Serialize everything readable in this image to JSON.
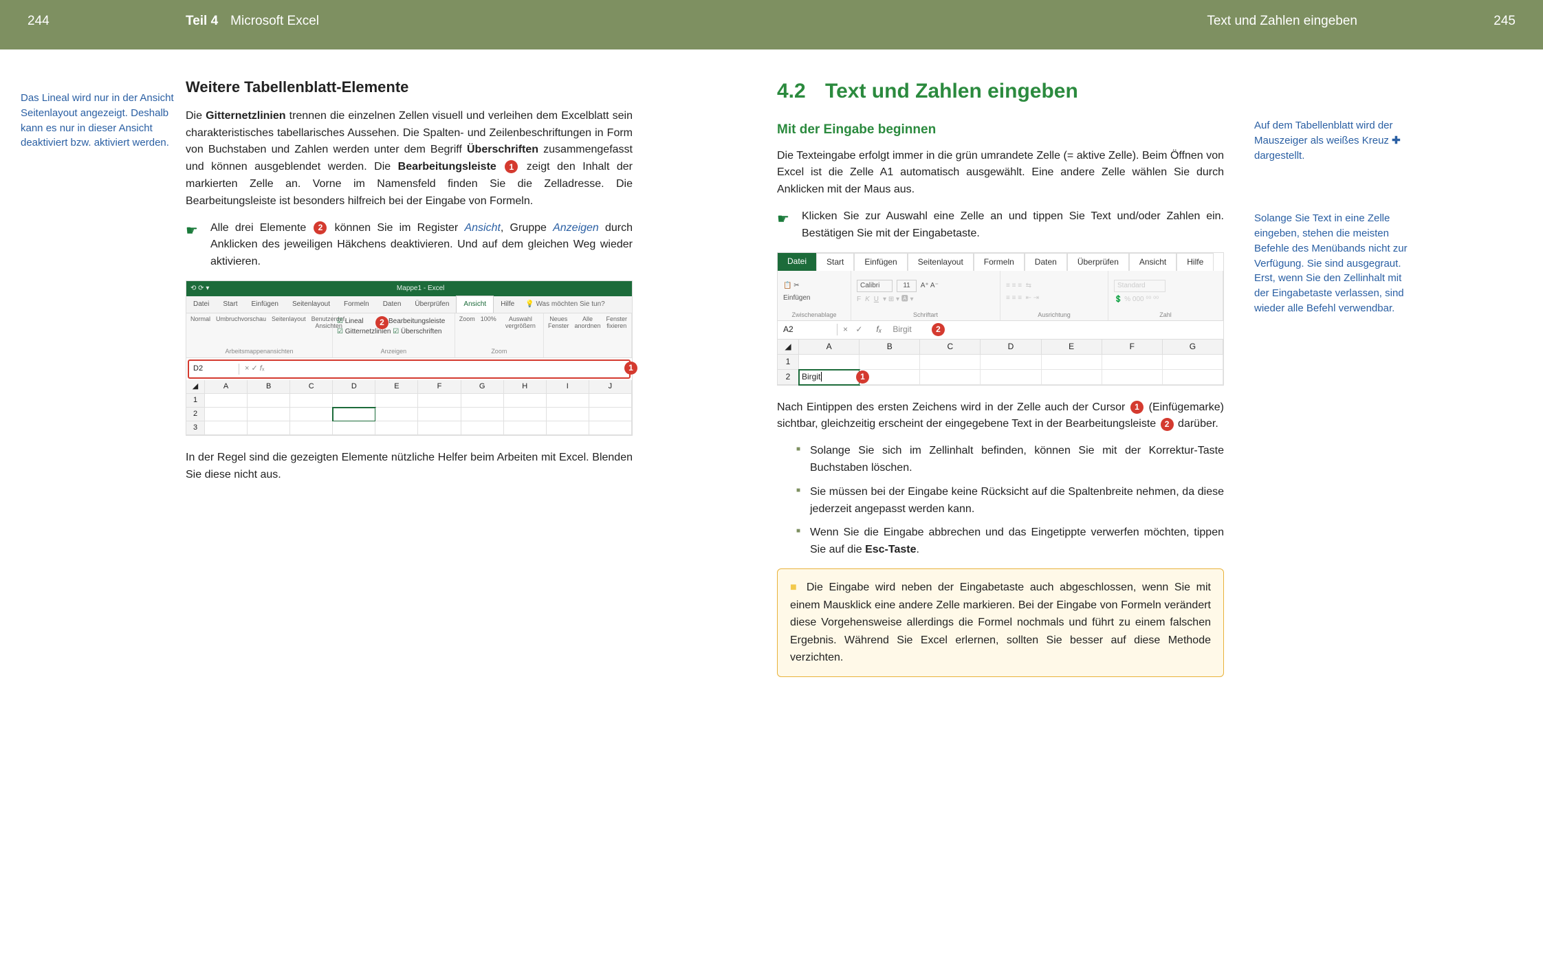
{
  "header": {
    "page_left": "244",
    "part": "Teil 4",
    "part_title": "Microsoft Excel",
    "right_title": "Text und Zahlen eingeben",
    "page_right": "245"
  },
  "left": {
    "margin_note": "Das Lineal wird nur in der Ansicht Seitenlayout angezeigt.  Deshalb kann es nur in dieser Ansicht deaktiviert bzw. aktiviert werden.",
    "h3": "Weitere Tabellenblatt-Elemente",
    "p1_pre": "Die ",
    "p1_b1": "Gitternetzlinien",
    "p1_mid1": " trennen die einzelnen Zellen visuell und verleihen dem Excelblatt sein charakteristisches tabellarisches Aussehen. Die Spalten- und Zeilenbeschriftungen in Form von Buchstaben und Zahlen werden unter dem Begriff ",
    "p1_b2": "Überschriften",
    "p1_mid2": " zusammengefasst und können ausgeblendet werden. Die ",
    "p1_b3": "Bearbeitungsleiste",
    "p1_mid3": " zeigt den Inhalt der markierten Zelle an. Vorne im Namensfeld finden Sie die Zelladresse. Die Bearbeitungsleiste ist besonders hilfreich bei der Eingabe von Formeln.",
    "tip_pre": "Alle drei Elemente ",
    "tip_mid": " können Sie im Register ",
    "tip_link1": "Ansicht",
    "tip_mid2": ", Gruppe ",
    "tip_link2": "Anzeigen",
    "tip_post": " durch Anklicken des jeweiligen Häkchens deaktivieren. Und auf dem gleichen Weg wieder aktivieren.",
    "p2": "In der Regel sind die gezeigten Elemente nützliche Helfer beim Arbeiten mit Excel. Blenden Sie diese nicht aus.",
    "screenshot": {
      "title": "Mappe1 - Excel",
      "tabs": [
        "Datei",
        "Start",
        "Einfügen",
        "Seitenlayout",
        "Formeln",
        "Daten",
        "Überprüfen",
        "Ansicht",
        "Hilfe"
      ],
      "tell": "Was möchten Sie tun?",
      "views": [
        "Normal",
        "Umbruchvorschau",
        "Seitenlayout",
        "Benutzerdef. Ansichten"
      ],
      "views_group": "Arbeitsmappenansichten",
      "show_opts": [
        "Lineal",
        "Bearbeitungsleiste",
        "Gitternetzlinien",
        "Überschriften"
      ],
      "show_group": "Anzeigen",
      "zoom": [
        "Zoom",
        "100%",
        "Auswahl vergrößern"
      ],
      "zoom_group": "Zoom",
      "window": [
        "Neues Fenster",
        "Alle anordnen",
        "Fenster fixieren"
      ],
      "namebox": "D2",
      "cols": [
        "A",
        "B",
        "C",
        "D",
        "E",
        "F",
        "G",
        "H",
        "I",
        "J"
      ],
      "rows": [
        "1",
        "2",
        "3"
      ]
    }
  },
  "right": {
    "sec_num": "4.2",
    "sec_title": "Text und Zahlen eingeben",
    "h3": "Mit der Eingabe beginnen",
    "p1": "Die Texteingabe erfolgt immer in die grün umrandete Zelle (= aktive Zelle). Beim Öffnen von Excel ist die Zelle A1 automatisch ausgewählt. Eine andere Zelle wählen Sie durch Anklicken mit der Maus aus.",
    "tip": "Klicken Sie zur Auswahl eine Zelle an und tippen Sie Text und/oder Zahlen ein. Bestätigen Sie mit der Eingabetaste.",
    "p2_pre": "Nach Eintippen des ersten Zeichens wird in der Zelle auch der Cursor ",
    "p2_mid": " (Einfügemarke) sichtbar, gleichzeitig erscheint der eingegebene Text in der Bearbeitungsleiste ",
    "p2_post": " darüber.",
    "bullets": [
      "Solange Sie sich im Zellinhalt befinden, können Sie mit der Korrektur-Taste Buchstaben löschen.",
      "Sie müssen bei der Eingabe keine Rücksicht auf die Spaltenbreite nehmen, da diese jederzeit angepasst werden kann."
    ],
    "bullet3_pre": "Wenn Sie die Eingabe abbrechen und das Eingetippte verwerfen möchten, tippen Sie auf die ",
    "bullet3_b": "Esc-Taste",
    "bullet3_post": ".",
    "note": "Die Eingabe wird neben der Eingabetaste auch abgeschlossen, wenn Sie  mit einem Mausklick eine andere Zelle markieren. Bei der Eingabe von Formeln verändert diese Vorgehensweise allerdings die Formel nochmals und führt zu einem falschen Ergebnis. Während Sie Excel erlernen, sollten Sie besser auf diese Methode verzichten.",
    "margin1_pre": "Auf dem Tabellenblatt wird der Mauszeiger als weißes Kreuz ",
    "margin1_post": " dargestellt.",
    "margin2": "Solange Sie Text in eine Zelle eingeben, stehen die meisten Befehle des Menübands nicht zur Verfügung. Sie sind ausgegraut. Erst, wenn Sie den Zellinhalt mit der Eingabetaste verlassen, sind wieder alle Befehl verwendbar.",
    "screenshot": {
      "tabs": [
        "Datei",
        "Start",
        "Einfügen",
        "Seitenlayout",
        "Formeln",
        "Daten",
        "Überprüfen",
        "Ansicht",
        "Hilfe"
      ],
      "paste": "Einfügen",
      "clip": "Zwischenablage",
      "font": "Calibri",
      "size": "11",
      "font_group": "Schriftart",
      "align_group": "Ausrichtung",
      "num_fmt": "Standard",
      "num_group": "Zahl",
      "namebox": "A2",
      "fx_val": "Birgit",
      "cols": [
        "A",
        "B",
        "C",
        "D",
        "E",
        "F",
        "G"
      ],
      "rows": [
        "1",
        "2"
      ],
      "cell_val": "Birgit"
    }
  }
}
